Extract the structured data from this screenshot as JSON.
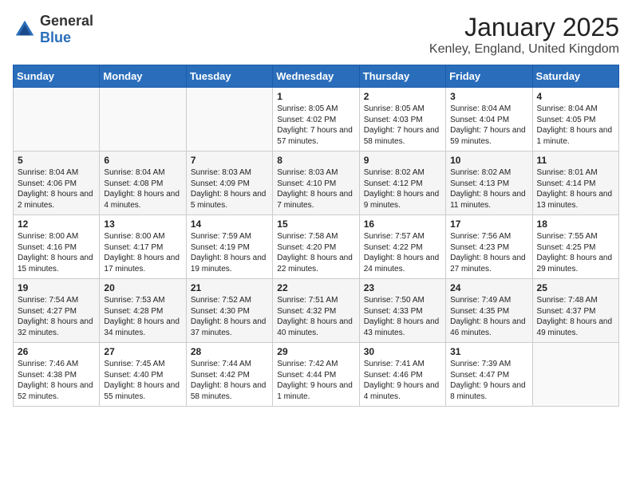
{
  "header": {
    "logo_general": "General",
    "logo_blue": "Blue",
    "title": "January 2025",
    "subtitle": "Kenley, England, United Kingdom"
  },
  "days_of_week": [
    "Sunday",
    "Monday",
    "Tuesday",
    "Wednesday",
    "Thursday",
    "Friday",
    "Saturday"
  ],
  "weeks": [
    [
      {
        "day": "",
        "info": ""
      },
      {
        "day": "",
        "info": ""
      },
      {
        "day": "",
        "info": ""
      },
      {
        "day": "1",
        "info": "Sunrise: 8:05 AM\nSunset: 4:02 PM\nDaylight: 7 hours and 57 minutes."
      },
      {
        "day": "2",
        "info": "Sunrise: 8:05 AM\nSunset: 4:03 PM\nDaylight: 7 hours and 58 minutes."
      },
      {
        "day": "3",
        "info": "Sunrise: 8:04 AM\nSunset: 4:04 PM\nDaylight: 7 hours and 59 minutes."
      },
      {
        "day": "4",
        "info": "Sunrise: 8:04 AM\nSunset: 4:05 PM\nDaylight: 8 hours and 1 minute."
      }
    ],
    [
      {
        "day": "5",
        "info": "Sunrise: 8:04 AM\nSunset: 4:06 PM\nDaylight: 8 hours and 2 minutes."
      },
      {
        "day": "6",
        "info": "Sunrise: 8:04 AM\nSunset: 4:08 PM\nDaylight: 8 hours and 4 minutes."
      },
      {
        "day": "7",
        "info": "Sunrise: 8:03 AM\nSunset: 4:09 PM\nDaylight: 8 hours and 5 minutes."
      },
      {
        "day": "8",
        "info": "Sunrise: 8:03 AM\nSunset: 4:10 PM\nDaylight: 8 hours and 7 minutes."
      },
      {
        "day": "9",
        "info": "Sunrise: 8:02 AM\nSunset: 4:12 PM\nDaylight: 8 hours and 9 minutes."
      },
      {
        "day": "10",
        "info": "Sunrise: 8:02 AM\nSunset: 4:13 PM\nDaylight: 8 hours and 11 minutes."
      },
      {
        "day": "11",
        "info": "Sunrise: 8:01 AM\nSunset: 4:14 PM\nDaylight: 8 hours and 13 minutes."
      }
    ],
    [
      {
        "day": "12",
        "info": "Sunrise: 8:00 AM\nSunset: 4:16 PM\nDaylight: 8 hours and 15 minutes."
      },
      {
        "day": "13",
        "info": "Sunrise: 8:00 AM\nSunset: 4:17 PM\nDaylight: 8 hours and 17 minutes."
      },
      {
        "day": "14",
        "info": "Sunrise: 7:59 AM\nSunset: 4:19 PM\nDaylight: 8 hours and 19 minutes."
      },
      {
        "day": "15",
        "info": "Sunrise: 7:58 AM\nSunset: 4:20 PM\nDaylight: 8 hours and 22 minutes."
      },
      {
        "day": "16",
        "info": "Sunrise: 7:57 AM\nSunset: 4:22 PM\nDaylight: 8 hours and 24 minutes."
      },
      {
        "day": "17",
        "info": "Sunrise: 7:56 AM\nSunset: 4:23 PM\nDaylight: 8 hours and 27 minutes."
      },
      {
        "day": "18",
        "info": "Sunrise: 7:55 AM\nSunset: 4:25 PM\nDaylight: 8 hours and 29 minutes."
      }
    ],
    [
      {
        "day": "19",
        "info": "Sunrise: 7:54 AM\nSunset: 4:27 PM\nDaylight: 8 hours and 32 minutes."
      },
      {
        "day": "20",
        "info": "Sunrise: 7:53 AM\nSunset: 4:28 PM\nDaylight: 8 hours and 34 minutes."
      },
      {
        "day": "21",
        "info": "Sunrise: 7:52 AM\nSunset: 4:30 PM\nDaylight: 8 hours and 37 minutes."
      },
      {
        "day": "22",
        "info": "Sunrise: 7:51 AM\nSunset: 4:32 PM\nDaylight: 8 hours and 40 minutes."
      },
      {
        "day": "23",
        "info": "Sunrise: 7:50 AM\nSunset: 4:33 PM\nDaylight: 8 hours and 43 minutes."
      },
      {
        "day": "24",
        "info": "Sunrise: 7:49 AM\nSunset: 4:35 PM\nDaylight: 8 hours and 46 minutes."
      },
      {
        "day": "25",
        "info": "Sunrise: 7:48 AM\nSunset: 4:37 PM\nDaylight: 8 hours and 49 minutes."
      }
    ],
    [
      {
        "day": "26",
        "info": "Sunrise: 7:46 AM\nSunset: 4:38 PM\nDaylight: 8 hours and 52 minutes."
      },
      {
        "day": "27",
        "info": "Sunrise: 7:45 AM\nSunset: 4:40 PM\nDaylight: 8 hours and 55 minutes."
      },
      {
        "day": "28",
        "info": "Sunrise: 7:44 AM\nSunset: 4:42 PM\nDaylight: 8 hours and 58 minutes."
      },
      {
        "day": "29",
        "info": "Sunrise: 7:42 AM\nSunset: 4:44 PM\nDaylight: 9 hours and 1 minute."
      },
      {
        "day": "30",
        "info": "Sunrise: 7:41 AM\nSunset: 4:46 PM\nDaylight: 9 hours and 4 minutes."
      },
      {
        "day": "31",
        "info": "Sunrise: 7:39 AM\nSunset: 4:47 PM\nDaylight: 9 hours and 8 minutes."
      },
      {
        "day": "",
        "info": ""
      }
    ]
  ]
}
